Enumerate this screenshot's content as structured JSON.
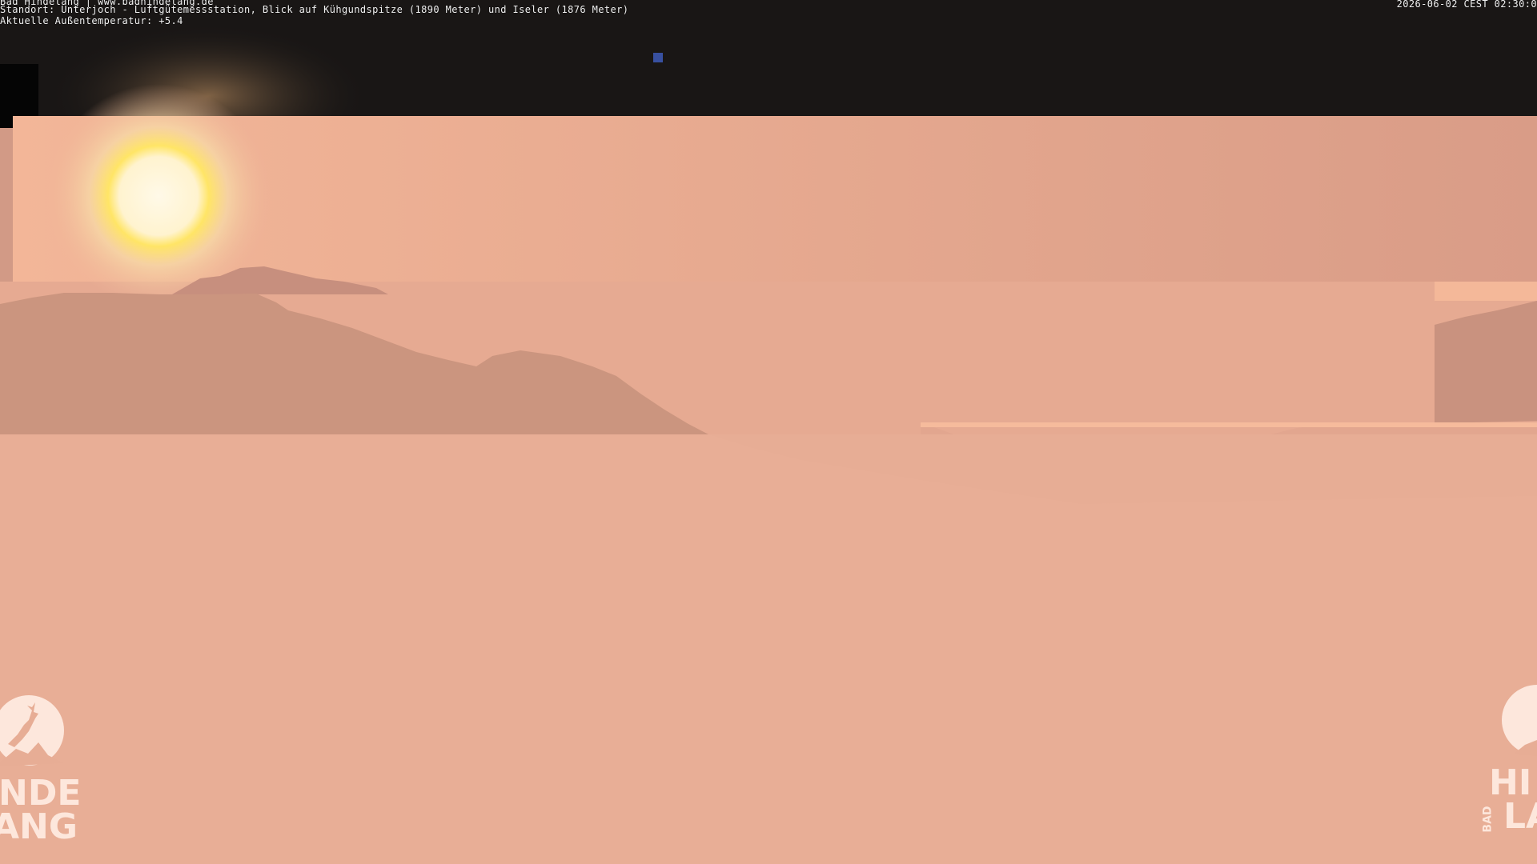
{
  "overlay": {
    "line1": "Bad Hindelang | www.badhindelang.de",
    "line2": "Standort: Unterjoch - Luftgütemessstation, Blick auf Kühgundspitze (1890 Meter) und Iseler (1876 Meter)",
    "line3": "Aktuelle Außentemperatur: +5.4",
    "timestamp": "2026-06-02 CEST 02:30:0"
  },
  "logo_left": {
    "line1": "NDE",
    "line2": "ANG"
  },
  "logo_right": {
    "line1": "HI",
    "line2": "LA",
    "small": "BAD"
  },
  "colors": {
    "sky_dark": "#1a1716",
    "sky_peach": "#e4a58e",
    "sun": "#fff6df",
    "mountain": "#c8937f",
    "foreground": "#e7ad95",
    "logo": "#fde7dc"
  },
  "icons": {
    "logo_left": "deer-logo-icon",
    "logo_right": "deer-logo-icon"
  }
}
